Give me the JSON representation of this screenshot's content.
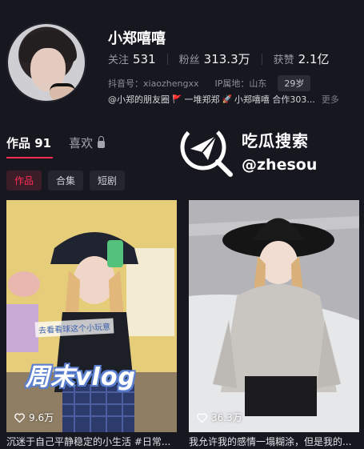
{
  "profile": {
    "name": "小郑嘻嘻",
    "stats": [
      {
        "label": "关注",
        "value": "531"
      },
      {
        "label": "粉丝",
        "value": "313.3万"
      },
      {
        "label": "获赞",
        "value": "2.1亿"
      }
    ],
    "douyin_id": "抖音号：xiaozhengxx",
    "ip_location": "IP属地：山东",
    "age": "29岁",
    "friends_line": {
      "item1": "@小郑的朋友圈",
      "item2": "一堆郑郑",
      "item3": "小郑嘻嘻 合作303...",
      "more": "更多"
    }
  },
  "tabs": {
    "works": "作品 91",
    "likes": "喜欢"
  },
  "chips": [
    "作品",
    "合集",
    "短剧"
  ],
  "watermark": {
    "title": "吃瓜搜索",
    "handle": "@zhesou"
  },
  "videos": [
    {
      "likes": "9.6万",
      "caption": "沉迷于自己平静稳定的小生活 #日常...",
      "overlay_title": "周末vlog",
      "overlay_banner": "去看看球这个小玩意"
    },
    {
      "likes": "36.3万",
      "caption": "我允许我的感情一塌糊涂，但是我的..."
    }
  ],
  "colors": {
    "background": "#16171f",
    "accent": "#fe2c55"
  }
}
